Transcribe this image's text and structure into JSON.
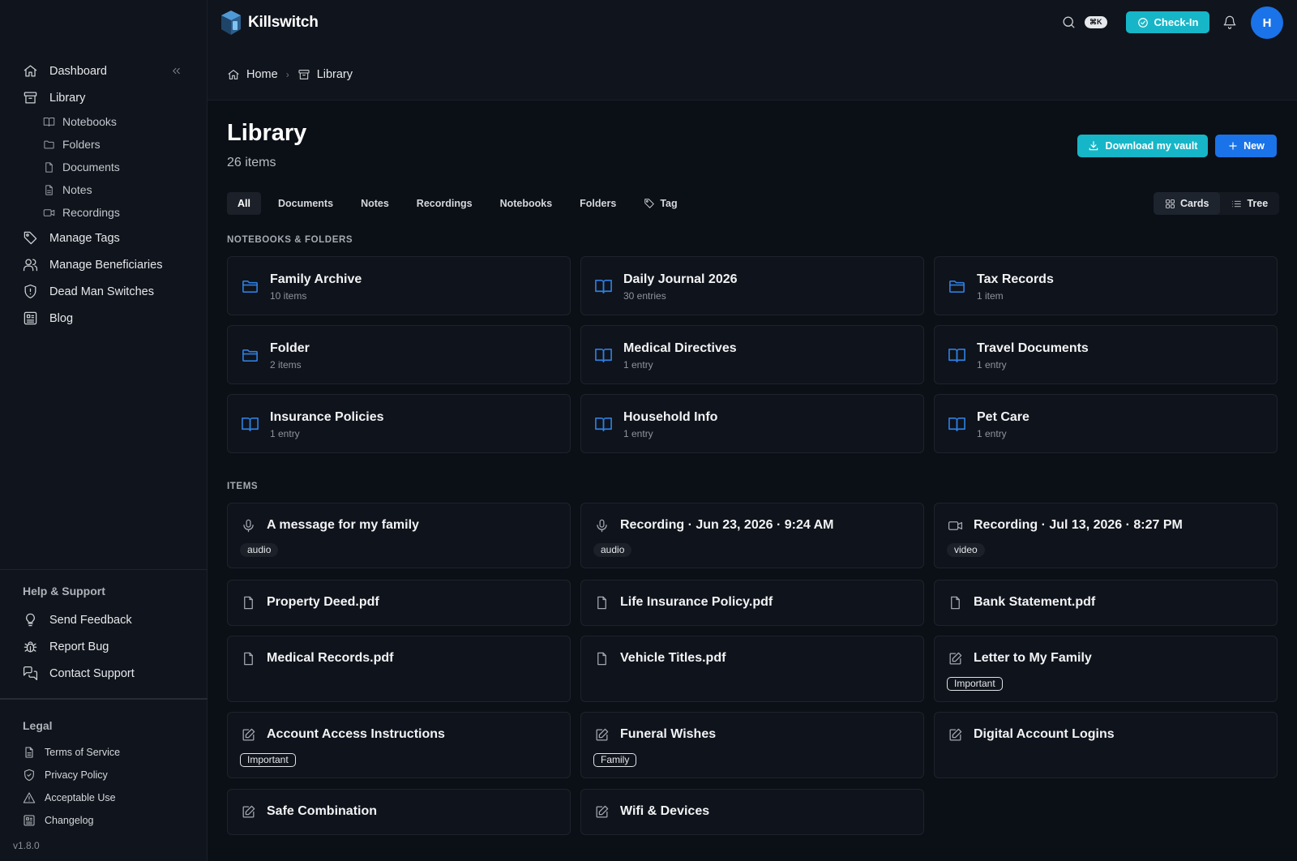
{
  "app": {
    "name": "Killswitch",
    "version": "v1.8.0"
  },
  "header": {
    "shortcut": "⌘K",
    "checkin_label": "Check-In",
    "avatar_initial": "H"
  },
  "breadcrumb": {
    "home": "Home",
    "current": "Library"
  },
  "sidebar": {
    "dashboard": "Dashboard",
    "library": "Library",
    "library_children": {
      "notebooks": "Notebooks",
      "folders": "Folders",
      "documents": "Documents",
      "notes": "Notes",
      "recordings": "Recordings"
    },
    "manage_tags": "Manage Tags",
    "manage_beneficiaries": "Manage Beneficiaries",
    "dead_man_switches": "Dead Man Switches",
    "blog": "Blog",
    "help_heading": "Help & Support",
    "send_feedback": "Send Feedback",
    "report_bug": "Report Bug",
    "contact_support": "Contact Support",
    "legal_heading": "Legal",
    "terms": "Terms of Service",
    "privacy": "Privacy Policy",
    "acceptable_use": "Acceptable Use",
    "changelog": "Changelog"
  },
  "page": {
    "title": "Library",
    "count": "26 items",
    "download_label": "Download my vault",
    "new_label": "New",
    "tabs": {
      "all": "All",
      "documents": "Documents",
      "notes": "Notes",
      "recordings": "Recordings",
      "notebooks": "Notebooks",
      "folders": "Folders",
      "tag": "Tag"
    },
    "view": {
      "cards": "Cards",
      "tree": "Tree"
    }
  },
  "sections": {
    "collections": "NOTEBOOKS & FOLDERS",
    "items": "ITEMS"
  },
  "collections": [
    {
      "name": "Family Archive",
      "meta": "10 items",
      "icon": "folder-icon"
    },
    {
      "name": "Daily Journal 2026",
      "meta": "30 entries",
      "icon": "notebook-icon"
    },
    {
      "name": "Tax Records",
      "meta": "1 item",
      "icon": "folder-icon"
    },
    {
      "name": "Folder",
      "meta": "2 items",
      "icon": "folder-icon"
    },
    {
      "name": "Medical Directives",
      "meta": "1 entry",
      "icon": "notebook-icon"
    },
    {
      "name": "Travel Documents",
      "meta": "1 entry",
      "icon": "notebook-icon"
    },
    {
      "name": "Insurance Policies",
      "meta": "1 entry",
      "icon": "notebook-icon"
    },
    {
      "name": "Household Info",
      "meta": "1 entry",
      "icon": "notebook-icon"
    },
    {
      "name": "Pet Care",
      "meta": "1 entry",
      "icon": "notebook-icon"
    }
  ],
  "items": [
    {
      "name": "A message for my family",
      "tag": "audio",
      "icon": "microphone-icon"
    },
    {
      "name": "Recording · Jun 23, 2026 · 9:24 AM",
      "tag": "audio",
      "icon": "microphone-icon"
    },
    {
      "name": "Recording · Jul 13, 2026 · 8:27 PM",
      "tag": "video",
      "icon": "video-icon"
    },
    {
      "name": "Property Deed.pdf",
      "icon": "file-icon"
    },
    {
      "name": "Life Insurance Policy.pdf",
      "icon": "file-icon"
    },
    {
      "name": "Bank Statement.pdf",
      "icon": "file-icon"
    },
    {
      "name": "Medical Records.pdf",
      "icon": "file-icon"
    },
    {
      "name": "Vehicle Titles.pdf",
      "icon": "file-icon"
    },
    {
      "name": "Letter to My Family",
      "tag": "Important",
      "icon": "edit-icon"
    },
    {
      "name": "Account Access Instructions",
      "tag": "Important",
      "icon": "edit-icon"
    },
    {
      "name": "Funeral Wishes",
      "tag": "Family",
      "icon": "edit-icon"
    },
    {
      "name": "Digital Account Logins",
      "icon": "edit-icon"
    },
    {
      "name": "Safe Combination",
      "icon": "edit-icon"
    },
    {
      "name": "Wifi & Devices",
      "icon": "edit-icon"
    }
  ],
  "colors": {
    "accent_teal": "#16b6c8",
    "accent_blue": "#1a73e8",
    "folder_blue": "#2f7fe0",
    "background": "#0b0f16"
  }
}
